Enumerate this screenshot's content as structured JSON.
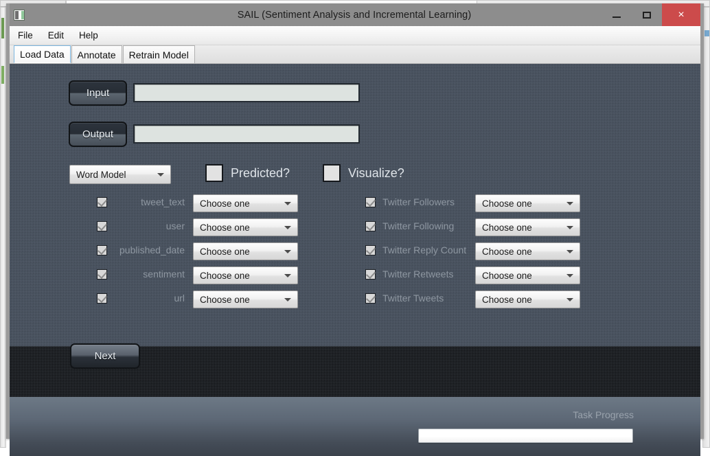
{
  "window": {
    "title": "SAIL (Sentiment Analysis and Incremental Learning)",
    "icon": "app-icon",
    "controls": {
      "minimize": "–",
      "maximize": "□",
      "close": "×"
    },
    "close_color": "#cc4b4b"
  },
  "menu": {
    "items": [
      "File",
      "Edit",
      "Help"
    ]
  },
  "tabs": {
    "selected": "Load Data",
    "items": [
      "Load Data",
      "Annotate",
      "Retrain Model"
    ]
  },
  "form": {
    "input": {
      "button_label": "Input",
      "value": "",
      "placeholder": ""
    },
    "output": {
      "button_label": "Output",
      "value": "",
      "placeholder": ""
    },
    "model_select": {
      "value": "Word Model",
      "options": [
        "Word Model"
      ]
    },
    "predicted": {
      "label": "Predicted?",
      "checked": false
    },
    "visualize": {
      "label": "Visualize?",
      "checked": false
    },
    "left_fields": [
      {
        "label": "tweet_text",
        "checked": true,
        "select_value": "Choose one"
      },
      {
        "label": "user",
        "checked": true,
        "select_value": "Choose one"
      },
      {
        "label": "published_date",
        "checked": true,
        "select_value": "Choose one"
      },
      {
        "label": "sentiment",
        "checked": true,
        "select_value": "Choose one"
      },
      {
        "label": "url",
        "checked": true,
        "select_value": "Choose one"
      }
    ],
    "right_fields": [
      {
        "label": "Twitter Followers",
        "checked": true,
        "select_value": "Choose one"
      },
      {
        "label": "Twitter Following",
        "checked": true,
        "select_value": "Choose one"
      },
      {
        "label": "Twitter Reply Count",
        "checked": true,
        "select_value": "Choose one"
      },
      {
        "label": "Twitter Retweets",
        "checked": true,
        "select_value": "Choose one"
      },
      {
        "label": "Twitter Tweets",
        "checked": true,
        "select_value": "Choose one"
      }
    ],
    "next_button": "Next"
  },
  "footer": {
    "task_progress_label": "Task Progress",
    "progress_percent": 0
  }
}
